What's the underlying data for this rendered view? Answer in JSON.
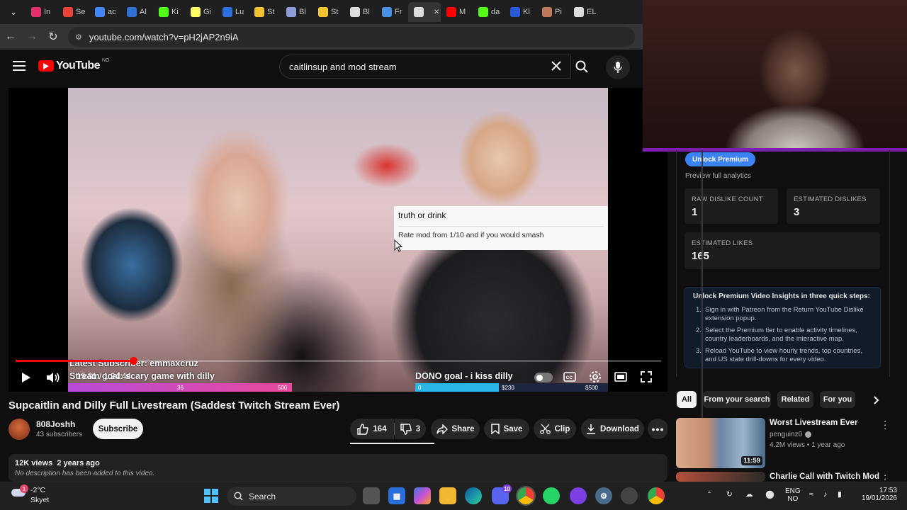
{
  "browser": {
    "tabs": [
      {
        "label": "In",
        "icon": "instagram-icon",
        "color": "#e1306c"
      },
      {
        "label": "Se",
        "icon": "gmail-icon",
        "color": "#ea4335"
      },
      {
        "label": "ac",
        "icon": "search-icon",
        "color": "#4285f4"
      },
      {
        "label": "Al",
        "icon": "ai-icon",
        "color": "#2f6fd6"
      },
      {
        "label": "Ki",
        "icon": "kick-icon",
        "color": "#53fc18"
      },
      {
        "label": "Gi",
        "icon": "genius-icon",
        "color": "#ffff64"
      },
      {
        "label": "Lu",
        "icon": "lu-icon",
        "color": "#2e6fe0"
      },
      {
        "label": "St",
        "icon": "crown-icon",
        "color": "#f4c430"
      },
      {
        "label": "Bl",
        "icon": "bl-icon",
        "color": "#8e9dd6"
      },
      {
        "label": "St",
        "icon": "crown-icon",
        "color": "#f4c430"
      },
      {
        "label": "Bl",
        "icon": "openai-icon",
        "color": "#ddd"
      },
      {
        "label": "Fr",
        "icon": "doc-icon",
        "color": "#4a90e2"
      },
      {
        "label": "",
        "icon": "audio-icon",
        "color": "#ddd"
      },
      {
        "label": "M",
        "icon": "youtube-icon",
        "color": "#ff0000"
      },
      {
        "label": "da",
        "icon": "kick-icon",
        "color": "#53fc18"
      },
      {
        "label": "Kl",
        "icon": "kl-icon",
        "color": "#2a5bd7"
      },
      {
        "label": "Pi",
        "icon": "person-icon",
        "color": "#c0785a"
      },
      {
        "label": "EL",
        "icon": "el-icon",
        "color": "#ddd"
      }
    ],
    "url": "youtube.com/watch?v=pH2jAP2n9iA"
  },
  "youtube": {
    "logo_text": "YouTube",
    "region": "NO",
    "search_value": "caitlinsup and mod stream"
  },
  "player": {
    "overlay_title": "truth or drink",
    "overlay_message": "Rate mod from 1/10 and if you would smash",
    "stream_sub_text": "Latest Subscriber: emmaxcruz",
    "stream_sub_text2": "Stream goal: scary game with dilly",
    "sub_goal_current": "36",
    "sub_goal_target": "500",
    "dono_goal_text": "DONO goal - i kiss dilly",
    "dono_goal_start": "0",
    "dono_goal_current": "$230",
    "dono_goal_target": "$500",
    "time": "15:31 / 1:24:44",
    "progress": 0.183
  },
  "video": {
    "title": "Supcaitlin and Dilly Full Livestream (Saddest Twitch Stream Ever)",
    "channel": "808Joshh",
    "subscribers": "43 subscribers",
    "subscribe_label": "Subscribe",
    "likes": "164",
    "dislikes": "3",
    "share_label": "Share",
    "save_label": "Save",
    "clip_label": "Clip",
    "download_label": "Download",
    "views": "12K views",
    "age": "2 years ago",
    "description": "No description has been added to this video."
  },
  "extension": {
    "premium_label": "Unlock Premium",
    "preview_text": "Preview full analytics",
    "raw_dislike_label": "RAW DISLIKE COUNT",
    "raw_dislike_value": "1",
    "est_dislikes_label": "ESTIMATED DISLIKES",
    "est_dislikes_value": "3",
    "est_likes_label": "ESTIMATED LIKES",
    "est_likes_value": "165",
    "insights_title": "Unlock Premium Video Insights in three quick steps:",
    "steps": [
      "Sign in with Patreon from the Return YouTube Dislike extension popup.",
      "Select the Premium tier to enable activity timelines, country leaderboards, and the interactive map.",
      "Reload YouTube to view hourly trends, top countries, and US state drill-downs for every video."
    ]
  },
  "chips": [
    "All",
    "From your search",
    "Related",
    "For you"
  ],
  "recommendations": [
    {
      "title": "Worst Livestream Ever",
      "channel": "penguinz0",
      "meta": "4.2M views • 1 year ago",
      "duration": "11:59"
    },
    {
      "title": "Charlie Call with Twitch Mod",
      "channel": "",
      "meta": "",
      "duration": ""
    }
  ],
  "taskbar": {
    "temperature": "-2°C",
    "weather": "Skyet",
    "weather_badge": "1",
    "search_label": "Search",
    "lang1": "ENG",
    "lang2": "NO",
    "time": "17:53",
    "date": "19/01/2026",
    "discord_badge": "10"
  }
}
